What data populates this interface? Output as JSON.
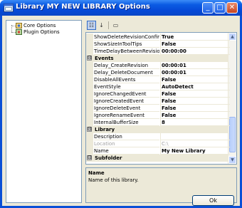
{
  "window": {
    "title": "Library MY NEW LIBRARY Options",
    "minimize_glyph": "_",
    "maximize_glyph": "□",
    "close_glyph": "✕"
  },
  "tree": {
    "items": [
      {
        "label": "Core Options"
      },
      {
        "label": "Plugin Options"
      }
    ]
  },
  "toolbar": {
    "categorized_glyph": "☷",
    "alphabetical_glyph": "↓",
    "pages_glyph": "▭"
  },
  "grid": {
    "rows": [
      {
        "kind": "prop",
        "name": "ShowDeleteRevisionConfirm",
        "value": "True"
      },
      {
        "kind": "prop",
        "name": "ShowSizeInToolTips",
        "value": "False"
      },
      {
        "kind": "prop",
        "name": "TimeDelayBetweenRevisions",
        "value": "00:00:00"
      },
      {
        "kind": "cat",
        "name": "Events",
        "expander": "⊟"
      },
      {
        "kind": "prop",
        "name": "Delay_CreateRevision",
        "value": "00:00:01"
      },
      {
        "kind": "prop",
        "name": "Delay_DeleteDocument",
        "value": "00:00:01"
      },
      {
        "kind": "prop",
        "name": "DisableAllEvents",
        "value": "False"
      },
      {
        "kind": "prop",
        "name": "EventStyle",
        "value": "AutoDetect"
      },
      {
        "kind": "prop",
        "name": "IgnoreChangedEvent",
        "value": "False"
      },
      {
        "kind": "prop",
        "name": "IgnoreCreatedEvent",
        "value": "False"
      },
      {
        "kind": "prop",
        "name": "IgnoreDeleteEvent",
        "value": "False"
      },
      {
        "kind": "prop",
        "name": "IgnoreRenameEvent",
        "value": "False"
      },
      {
        "kind": "prop",
        "name": "InternalBufferSize",
        "value": "8"
      },
      {
        "kind": "cat",
        "name": "Library",
        "expander": "⊟"
      },
      {
        "kind": "prop",
        "name": "Description",
        "value": ""
      },
      {
        "kind": "prop",
        "name": "Location",
        "value": "C:\\",
        "disabled": true
      },
      {
        "kind": "prop",
        "name": "Name",
        "value": "My New Library",
        "selected": true
      },
      {
        "kind": "cat",
        "name": "Subfolder",
        "expander": "⊟"
      }
    ]
  },
  "help": {
    "name": "Name",
    "description": "Name of this library."
  },
  "buttons": {
    "ok_label": "Ok"
  },
  "colors": {
    "titlebar": "#0b5be3",
    "face": "#ece9d8",
    "border": "#7f9db9"
  }
}
